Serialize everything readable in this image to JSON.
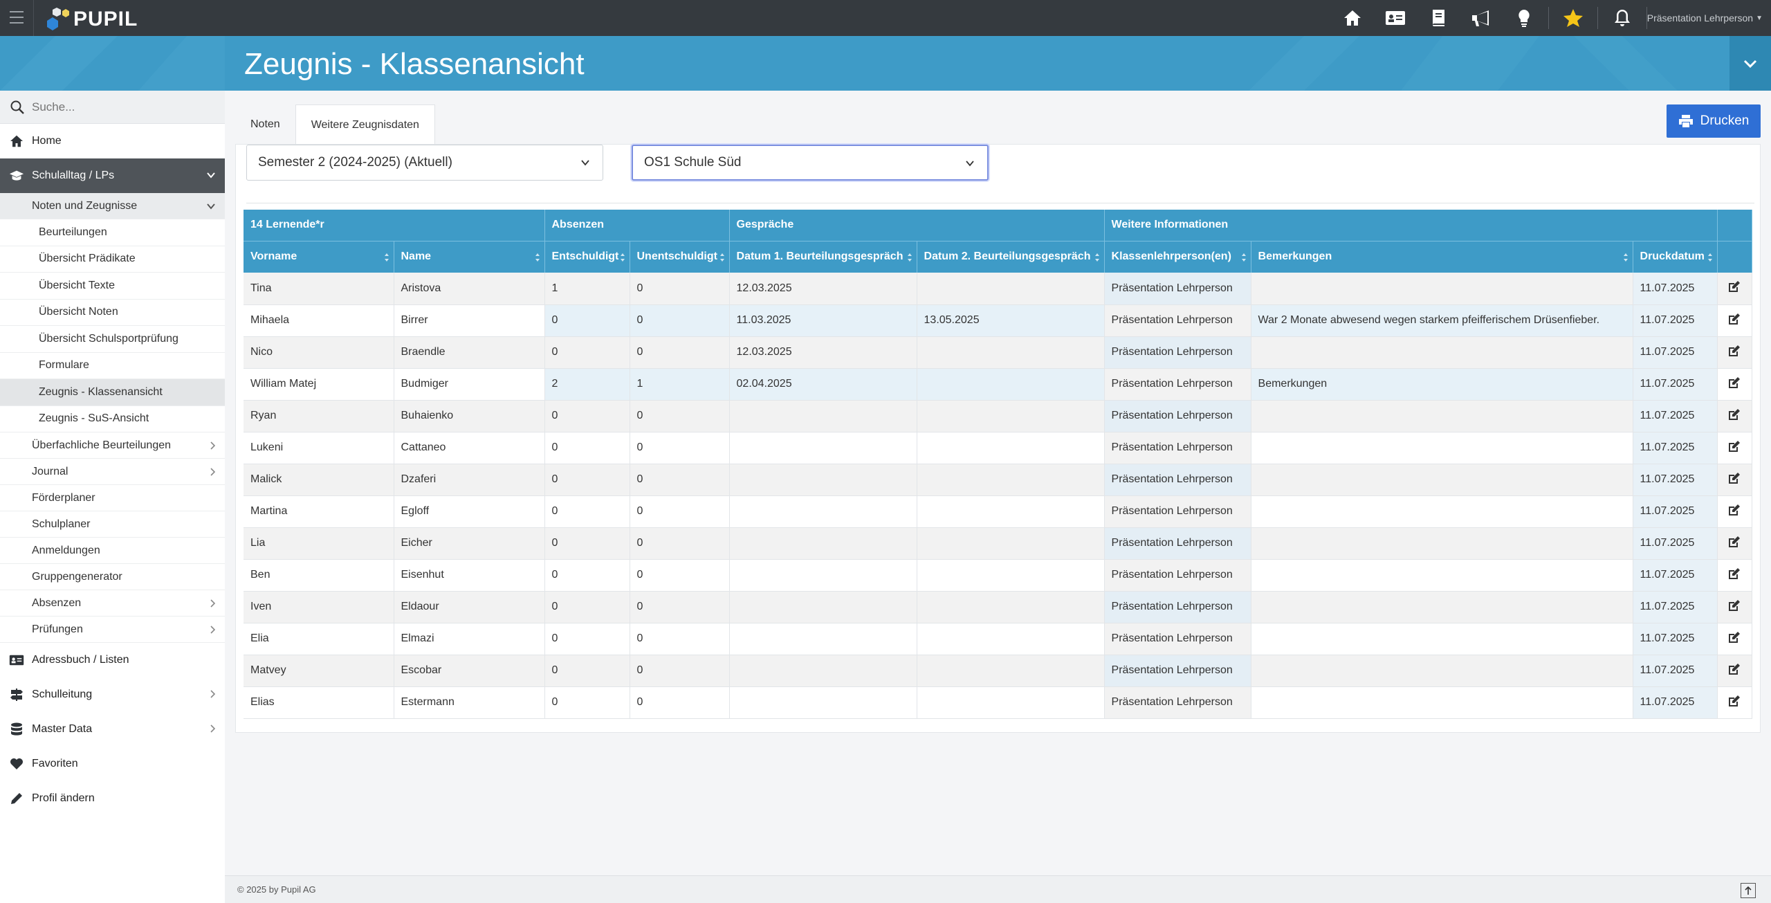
{
  "app": {
    "logo_text": "PUPIL"
  },
  "topbar": {
    "user_name": "Präsentation Lehrperson"
  },
  "search": {
    "placeholder": "Suche..."
  },
  "sidebar": {
    "items": [
      {
        "label": "Home"
      },
      {
        "label": "Schulalltag / LPs"
      },
      {
        "label": "Noten und Zeugnisse"
      },
      {
        "label": "Beurteilungen"
      },
      {
        "label": "Übersicht Prädikate"
      },
      {
        "label": "Übersicht Texte"
      },
      {
        "label": "Übersicht Noten"
      },
      {
        "label": "Übersicht Schulsportprüfung"
      },
      {
        "label": "Formulare"
      },
      {
        "label": "Zeugnis - Klassenansicht"
      },
      {
        "label": "Zeugnis - SuS-Ansicht"
      },
      {
        "label": "Überfachliche Beurteilungen"
      },
      {
        "label": "Journal"
      },
      {
        "label": "Förderplaner"
      },
      {
        "label": "Schulplaner"
      },
      {
        "label": "Anmeldungen"
      },
      {
        "label": "Gruppengenerator"
      },
      {
        "label": "Absenzen"
      },
      {
        "label": "Prüfungen"
      },
      {
        "label": "Adressbuch / Listen"
      },
      {
        "label": "Schulleitung"
      },
      {
        "label": "Master Data"
      },
      {
        "label": "Favoriten"
      },
      {
        "label": "Profil ändern"
      }
    ]
  },
  "page": {
    "title": "Zeugnis - Klassenansicht"
  },
  "tabs": [
    {
      "label": "Noten"
    },
    {
      "label": "Weitere Zeugnisdaten"
    }
  ],
  "print_button": {
    "label": "Drucken"
  },
  "filters": {
    "semester": "Semester 2 (2024-2025) (Aktuell)",
    "class": "OS1 Schule Süd"
  },
  "table": {
    "group_headers": [
      "14 Lernende*r",
      "Absenzen",
      "Gespräche",
      "Weitere Informationen"
    ],
    "columns": [
      "Vorname",
      "Name",
      "Entschuldigt",
      "Unentschuldigt",
      "Datum 1. Beurteilungsgespräch",
      "Datum 2. Beurteilungsgespräch",
      "Klassenlehrperson(en)",
      "Bemerkungen",
      "Druckdatum"
    ],
    "rows": [
      [
        "Tina",
        "Aristova",
        "1",
        "0",
        "12.03.2025",
        "",
        "Präsentation Lehrperson",
        "",
        "11.07.2025"
      ],
      [
        "Mihaela",
        "Birrer",
        "0",
        "0",
        "11.03.2025",
        "13.05.2025",
        "Präsentation Lehrperson",
        "War 2 Monate abwesend wegen starkem pfeifferischem Drüsenfieber.",
        "11.07.2025"
      ],
      [
        "Nico",
        "Braendle",
        "0",
        "0",
        "12.03.2025",
        "",
        "Präsentation Lehrperson",
        "",
        "11.07.2025"
      ],
      [
        "William Matej",
        "Budmiger",
        "2",
        "1",
        "02.04.2025",
        "",
        "Präsentation Lehrperson",
        "Bemerkungen",
        "11.07.2025"
      ],
      [
        "Ryan",
        "Buhaienko",
        "0",
        "0",
        "",
        "",
        "Präsentation Lehrperson",
        "",
        "11.07.2025"
      ],
      [
        "Lukeni",
        "Cattaneo",
        "0",
        "0",
        "",
        "",
        "Präsentation Lehrperson",
        "",
        "11.07.2025"
      ],
      [
        "Malick",
        "Dzaferi",
        "0",
        "0",
        "",
        "",
        "Präsentation Lehrperson",
        "",
        "11.07.2025"
      ],
      [
        "Martina",
        "Egloff",
        "0",
        "0",
        "",
        "",
        "Präsentation Lehrperson",
        "",
        "11.07.2025"
      ],
      [
        "Lia",
        "Eicher",
        "0",
        "0",
        "",
        "",
        "Präsentation Lehrperson",
        "",
        "11.07.2025"
      ],
      [
        "Ben",
        "Eisenhut",
        "0",
        "0",
        "",
        "",
        "Präsentation Lehrperson",
        "",
        "11.07.2025"
      ],
      [
        "Iven",
        "Eldaour",
        "0",
        "0",
        "",
        "",
        "Präsentation Lehrperson",
        "",
        "11.07.2025"
      ],
      [
        "Elia",
        "Elmazi",
        "0",
        "0",
        "",
        "",
        "Präsentation Lehrperson",
        "",
        "11.07.2025"
      ],
      [
        "Matvey",
        "Escobar",
        "0",
        "0",
        "",
        "",
        "Präsentation Lehrperson",
        "",
        "11.07.2025"
      ],
      [
        "Elias",
        "Estermann",
        "0",
        "0",
        "",
        "",
        "Präsentation Lehrperson",
        "",
        "11.07.2025"
      ]
    ]
  },
  "footer": {
    "copyright": "© 2025 by Pupil AG"
  },
  "colors": {
    "brand_blue": "#3e9bc7",
    "topbar": "#353a3f",
    "print_button": "#2f6fd5",
    "star": "#f5c518"
  }
}
